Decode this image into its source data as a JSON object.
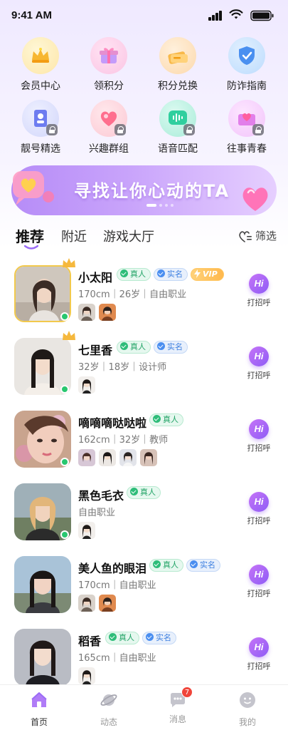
{
  "status_bar": {
    "time": "9:41 AM"
  },
  "quick_actions": [
    {
      "label": "会员中心",
      "icon": "crown-icon",
      "locked": false
    },
    {
      "label": "领积分",
      "icon": "gift-icon",
      "locked": false
    },
    {
      "label": "积分兑换",
      "icon": "coupon-icon",
      "locked": false
    },
    {
      "label": "防诈指南",
      "icon": "shield-icon",
      "locked": false
    },
    {
      "label": "靓号精选",
      "icon": "id-card-icon",
      "locked": true
    },
    {
      "label": "兴趣群组",
      "icon": "heart-group-icon",
      "locked": true
    },
    {
      "label": "语音匹配",
      "icon": "voice-wave-icon",
      "locked": true
    },
    {
      "label": "往事青春",
      "icon": "heart-letter-icon",
      "locked": true
    }
  ],
  "banner": {
    "title": "寻找让你心动的TA",
    "slide_count": 4,
    "active_slide": 0
  },
  "tabs": [
    {
      "label": "推荐",
      "active": true
    },
    {
      "label": "附近",
      "active": false
    },
    {
      "label": "游戏大厅",
      "active": false
    }
  ],
  "filter_label": "筛选",
  "users": [
    {
      "name": "小太阳",
      "info": "170cm｜26岁｜自由职业",
      "badges": [
        "真人",
        "实名",
        "VIP"
      ],
      "online": true,
      "crown": true,
      "photos": 2
    },
    {
      "name": "七里香",
      "info": "32岁｜18岁｜设计师",
      "badges": [
        "真人",
        "实名"
      ],
      "online": true,
      "crown": true,
      "photos": 1
    },
    {
      "name": "嘀嘀嘀哒哒啦",
      "info": "162cm｜32岁｜教师",
      "badges": [
        "真人"
      ],
      "online": true,
      "crown": false,
      "photos": 4
    },
    {
      "name": "黑色毛衣",
      "info": "自由职业",
      "badges": [
        "真人"
      ],
      "online": true,
      "crown": false,
      "photos": 1
    },
    {
      "name": "美人鱼的眼泪",
      "info": "170cm｜自由职业",
      "badges": [
        "真人",
        "实名"
      ],
      "online": false,
      "crown": false,
      "photos": 2
    },
    {
      "name": "稻香",
      "info": "165cm｜自由职业",
      "badges": [
        "真人",
        "实名"
      ],
      "online": false,
      "crown": false,
      "photos": 1
    }
  ],
  "greet": {
    "icon_text": "Hi",
    "label": "打招呼"
  },
  "bottom_nav": [
    {
      "label": "首页",
      "icon": "home-icon",
      "active": true
    },
    {
      "label": "动态",
      "icon": "planet-icon",
      "active": false
    },
    {
      "label": "消息",
      "icon": "chat-icon",
      "active": false,
      "badge": "7"
    },
    {
      "label": "我的",
      "icon": "profile-icon",
      "active": false
    }
  ],
  "colors": {
    "accent": "#9b6cf6",
    "real": "#2ebd79",
    "verified": "#4a8ef0",
    "vip": "#ffb84d",
    "online": "#28c76f",
    "badge": "#f0453a"
  }
}
